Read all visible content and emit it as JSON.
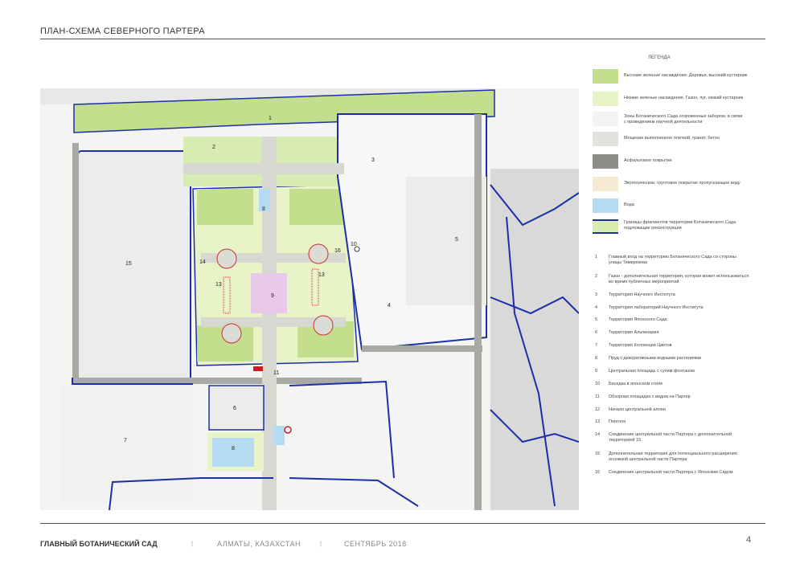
{
  "header": {
    "title": "ПЛАН-СХЕМА СЕВЕРНОГО ПАРТЕРА"
  },
  "legend": {
    "title": "ЛЕГЕНДА",
    "items": [
      {
        "color": "#c3df8e",
        "label": "Высокие зеленые насаждения. Деревья, высокий кустарник"
      },
      {
        "color": "#e9f3c8",
        "label": "Низкие зеленые насаждения. Газон, луг, низкий кустарник"
      },
      {
        "color": "#f3f3f3",
        "label": "Зоны Ботанического Сада огороженные забором, в связи с проведением научной деятельности"
      },
      {
        "color": "#e2e2de",
        "label": "Мощение выполненное плиткой, гранит, бетон"
      },
      {
        "color": "#8e8e88",
        "label": "Асфальтовое покрытие"
      },
      {
        "color": "#f6ead2",
        "label": "Экологическое, грунтовое покрытие пропускающее воду"
      },
      {
        "color": "#b3dcf2",
        "label": "Вода"
      },
      {
        "color": "#d6ecb3",
        "label": "Границы фрагментов территории Ботанического Сада подлежащие реконструкции"
      }
    ]
  },
  "numbered_list": [
    {
      "n": "1",
      "text": "Главный вход на территорию Ботанического Сада со стороны улицы Тимирязева"
    },
    {
      "n": "2",
      "text": "Газон - дополнительная территория, которая может использоваться во время публичных мероприятий"
    },
    {
      "n": "3",
      "text": "Территория Научного Института"
    },
    {
      "n": "4",
      "text": "Территория лабораторий Научного Института"
    },
    {
      "n": "5",
      "text": "Территория Японского Сада"
    },
    {
      "n": "6",
      "text": "Территория Альпинария"
    },
    {
      "n": "7",
      "text": "Территория Коллекции Цветов"
    },
    {
      "n": "8",
      "text": "Пруд с декоративными водными растениями"
    },
    {
      "n": "9",
      "text": "Центральная площадь с сухим фонтаном"
    },
    {
      "n": "10",
      "text": "Беседка в японском стиле"
    },
    {
      "n": "11",
      "text": "Обзорная площадка с видом на Партер"
    },
    {
      "n": "12",
      "text": "Начало центральной аллеи"
    },
    {
      "n": "13",
      "text": "Пергола"
    },
    {
      "n": "14",
      "text": "Соединение центральной части Партера с дополнительной территорией 15"
    },
    {
      "n": "15",
      "text": "Дополнительная территория для потенциального расширения основной центральной части Партера"
    },
    {
      "n": "16",
      "text": "Соединение центральной части Партера с Японским Садом"
    }
  ],
  "map_labels": [
    "1",
    "2",
    "3",
    "4",
    "5",
    "6",
    "7",
    "8",
    "8",
    "9",
    "10",
    "11",
    "13",
    "13",
    "14",
    "15",
    "16"
  ],
  "footer": {
    "org": "ГЛАВНЫЙ БОТАНИЧЕСКИЙ САД",
    "city": "АЛМАТЫ, КАЗАХСТАН",
    "date": "СЕНТЯБРЬ 2018",
    "separator": "|",
    "page": "4"
  }
}
